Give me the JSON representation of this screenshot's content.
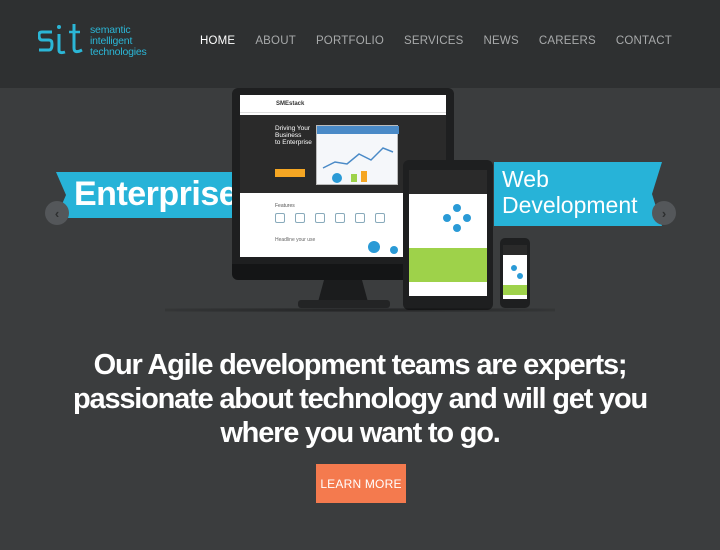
{
  "brand": {
    "name_lines": [
      "semantic",
      "intelligent",
      "technologies"
    ],
    "logo_letters": "sit",
    "color": "#2bb6d6"
  },
  "nav": {
    "items": [
      {
        "label": "HOME",
        "active": true
      },
      {
        "label": "ABOUT",
        "active": false
      },
      {
        "label": "PORTFOLIO",
        "active": false
      },
      {
        "label": "SERVICES",
        "active": false
      },
      {
        "label": "NEWS",
        "active": false
      },
      {
        "label": "CAREERS",
        "active": false
      },
      {
        "label": "CONTACT",
        "active": false
      }
    ]
  },
  "slider": {
    "left_ribbon": "Enterprise",
    "right_ribbon_lines": [
      "Web",
      "Development"
    ],
    "ribbon_color": "#27b3d8",
    "prev_icon": "chevron-left-icon",
    "next_icon": "chevron-right-icon",
    "prev_glyph": "‹",
    "next_glyph": "›",
    "mockup": {
      "site_name": "SMEstack",
      "hero_lines": [
        "Driving Your",
        "Business",
        "to Enterprise"
      ],
      "features_label": "Features",
      "section_label": "Headline your use"
    }
  },
  "hero": {
    "tagline_lines": [
      "Our Agile development teams are experts;",
      "passionate about technology and will get you",
      "where you want to go."
    ],
    "cta_label": "LEARN MORE",
    "cta_color": "#f47a4e"
  }
}
